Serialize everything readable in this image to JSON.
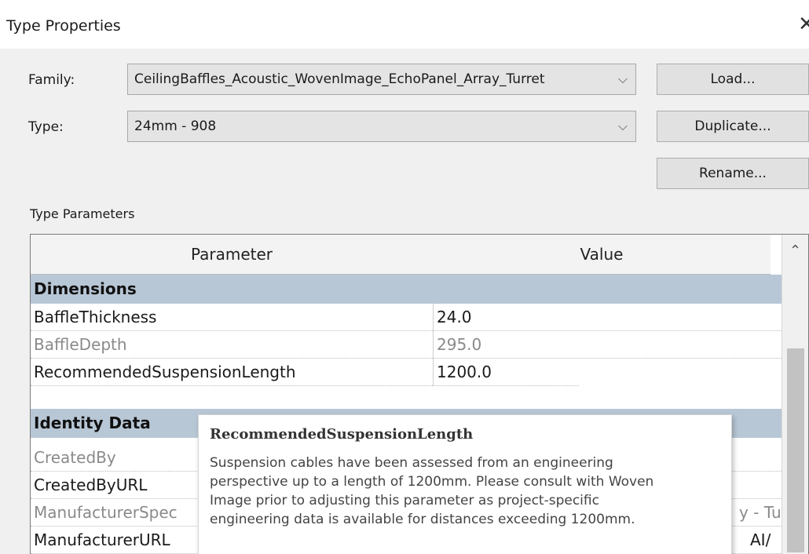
{
  "window": {
    "title": "Type Properties",
    "close_symbol": "✕"
  },
  "family": {
    "label": "Family:",
    "value": "CeilingBaffles_Acoustic_WovenImage_EchoPanel_Array_Turret"
  },
  "type": {
    "label": "Type:",
    "value": "24mm - 908"
  },
  "buttons": {
    "load": "Load...",
    "duplicate": "Duplicate...",
    "rename": "Rename..."
  },
  "type_parameters": {
    "label": "Type Parameters",
    "columns": {
      "parameter": "Parameter",
      "value": "Value"
    },
    "groups": [
      {
        "name": "Dimensions",
        "rows": [
          {
            "param": "BaffleThickness",
            "value": "24.0",
            "dimmed": false
          },
          {
            "param": "BaffleDepth",
            "value": "295.0",
            "dimmed": true
          },
          {
            "param": "RecommendedSuspensionLength",
            "value": "1200.0",
            "dimmed": false,
            "selected": true
          }
        ]
      },
      {
        "name": "Identity Data",
        "rows": [
          {
            "param": "CreatedBy",
            "value": "",
            "dimmed": true
          },
          {
            "param": "CreatedByURL",
            "value": "",
            "dimmed": false
          },
          {
            "param": "ManufacturerSpec",
            "value": "y - Tu",
            "dimmed": true
          },
          {
            "param": "ManufacturerURL",
            "value": "AI/",
            "dimmed": false
          }
        ]
      }
    ]
  },
  "tooltip": {
    "title": "RecommendedSuspensionLength",
    "lines": [
      "Suspension cables have been assessed from an engineering",
      "perspective up to a length of 1200mm. Please consult with Woven",
      "Image prior to adjusting this parameter as project-specific",
      "engineering data is available for distances exceeding 1200mm."
    ]
  },
  "icons": {
    "dropdown": "chevron-down-icon",
    "scroll_up": "chevron-up-icon",
    "close": "close-icon"
  },
  "colors": {
    "group_header": "#b8c7d6",
    "dialog_bg": "#f0f0f0"
  }
}
